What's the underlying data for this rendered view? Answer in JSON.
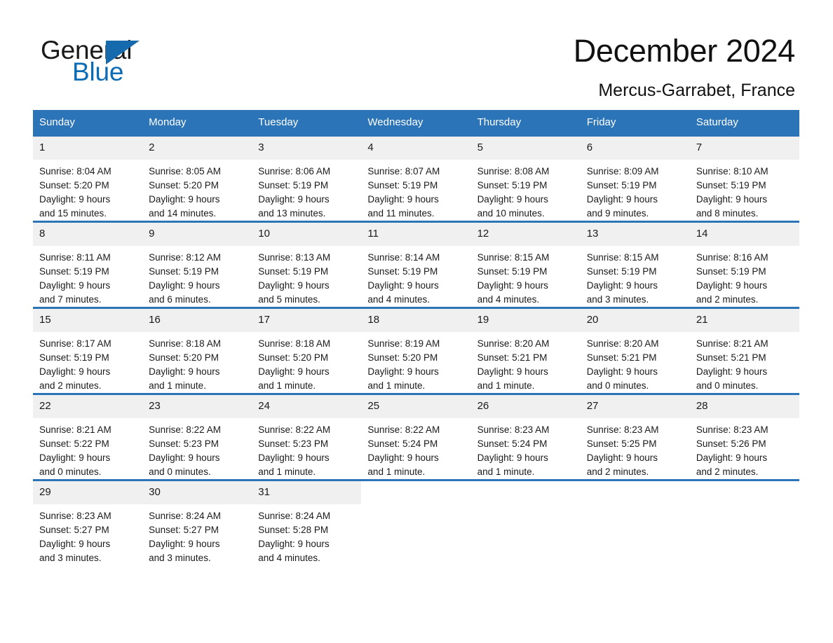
{
  "brand": {
    "name_part1": "General",
    "name_part2": "Blue",
    "triangle_color": "#1569ad",
    "blue_color": "#0b6cb5"
  },
  "header": {
    "title": "December 2024",
    "subtitle": "Mercus-Garrabet, France"
  },
  "theme": {
    "header_blue": "#2b74b8",
    "day_band_gray": "#f0f0f0",
    "text_color": "#1a1a1a"
  },
  "weekdays": [
    "Sunday",
    "Monday",
    "Tuesday",
    "Wednesday",
    "Thursday",
    "Friday",
    "Saturday"
  ],
  "weeks": [
    {
      "days": [
        {
          "day": "1",
          "sunrise": "Sunrise: 8:04 AM",
          "sunset": "Sunset: 5:20 PM",
          "daylight1": "Daylight: 9 hours",
          "daylight2": "and 15 minutes."
        },
        {
          "day": "2",
          "sunrise": "Sunrise: 8:05 AM",
          "sunset": "Sunset: 5:20 PM",
          "daylight1": "Daylight: 9 hours",
          "daylight2": "and 14 minutes."
        },
        {
          "day": "3",
          "sunrise": "Sunrise: 8:06 AM",
          "sunset": "Sunset: 5:19 PM",
          "daylight1": "Daylight: 9 hours",
          "daylight2": "and 13 minutes."
        },
        {
          "day": "4",
          "sunrise": "Sunrise: 8:07 AM",
          "sunset": "Sunset: 5:19 PM",
          "daylight1": "Daylight: 9 hours",
          "daylight2": "and 11 minutes."
        },
        {
          "day": "5",
          "sunrise": "Sunrise: 8:08 AM",
          "sunset": "Sunset: 5:19 PM",
          "daylight1": "Daylight: 9 hours",
          "daylight2": "and 10 minutes."
        },
        {
          "day": "6",
          "sunrise": "Sunrise: 8:09 AM",
          "sunset": "Sunset: 5:19 PM",
          "daylight1": "Daylight: 9 hours",
          "daylight2": "and 9 minutes."
        },
        {
          "day": "7",
          "sunrise": "Sunrise: 8:10 AM",
          "sunset": "Sunset: 5:19 PM",
          "daylight1": "Daylight: 9 hours",
          "daylight2": "and 8 minutes."
        }
      ]
    },
    {
      "days": [
        {
          "day": "8",
          "sunrise": "Sunrise: 8:11 AM",
          "sunset": "Sunset: 5:19 PM",
          "daylight1": "Daylight: 9 hours",
          "daylight2": "and 7 minutes."
        },
        {
          "day": "9",
          "sunrise": "Sunrise: 8:12 AM",
          "sunset": "Sunset: 5:19 PM",
          "daylight1": "Daylight: 9 hours",
          "daylight2": "and 6 minutes."
        },
        {
          "day": "10",
          "sunrise": "Sunrise: 8:13 AM",
          "sunset": "Sunset: 5:19 PM",
          "daylight1": "Daylight: 9 hours",
          "daylight2": "and 5 minutes."
        },
        {
          "day": "11",
          "sunrise": "Sunrise: 8:14 AM",
          "sunset": "Sunset: 5:19 PM",
          "daylight1": "Daylight: 9 hours",
          "daylight2": "and 4 minutes."
        },
        {
          "day": "12",
          "sunrise": "Sunrise: 8:15 AM",
          "sunset": "Sunset: 5:19 PM",
          "daylight1": "Daylight: 9 hours",
          "daylight2": "and 4 minutes."
        },
        {
          "day": "13",
          "sunrise": "Sunrise: 8:15 AM",
          "sunset": "Sunset: 5:19 PM",
          "daylight1": "Daylight: 9 hours",
          "daylight2": "and 3 minutes."
        },
        {
          "day": "14",
          "sunrise": "Sunrise: 8:16 AM",
          "sunset": "Sunset: 5:19 PM",
          "daylight1": "Daylight: 9 hours",
          "daylight2": "and 2 minutes."
        }
      ]
    },
    {
      "days": [
        {
          "day": "15",
          "sunrise": "Sunrise: 8:17 AM",
          "sunset": "Sunset: 5:19 PM",
          "daylight1": "Daylight: 9 hours",
          "daylight2": "and 2 minutes."
        },
        {
          "day": "16",
          "sunrise": "Sunrise: 8:18 AM",
          "sunset": "Sunset: 5:20 PM",
          "daylight1": "Daylight: 9 hours",
          "daylight2": "and 1 minute."
        },
        {
          "day": "17",
          "sunrise": "Sunrise: 8:18 AM",
          "sunset": "Sunset: 5:20 PM",
          "daylight1": "Daylight: 9 hours",
          "daylight2": "and 1 minute."
        },
        {
          "day": "18",
          "sunrise": "Sunrise: 8:19 AM",
          "sunset": "Sunset: 5:20 PM",
          "daylight1": "Daylight: 9 hours",
          "daylight2": "and 1 minute."
        },
        {
          "day": "19",
          "sunrise": "Sunrise: 8:20 AM",
          "sunset": "Sunset: 5:21 PM",
          "daylight1": "Daylight: 9 hours",
          "daylight2": "and 1 minute."
        },
        {
          "day": "20",
          "sunrise": "Sunrise: 8:20 AM",
          "sunset": "Sunset: 5:21 PM",
          "daylight1": "Daylight: 9 hours",
          "daylight2": "and 0 minutes."
        },
        {
          "day": "21",
          "sunrise": "Sunrise: 8:21 AM",
          "sunset": "Sunset: 5:21 PM",
          "daylight1": "Daylight: 9 hours",
          "daylight2": "and 0 minutes."
        }
      ]
    },
    {
      "days": [
        {
          "day": "22",
          "sunrise": "Sunrise: 8:21 AM",
          "sunset": "Sunset: 5:22 PM",
          "daylight1": "Daylight: 9 hours",
          "daylight2": "and 0 minutes."
        },
        {
          "day": "23",
          "sunrise": "Sunrise: 8:22 AM",
          "sunset": "Sunset: 5:23 PM",
          "daylight1": "Daylight: 9 hours",
          "daylight2": "and 0 minutes."
        },
        {
          "day": "24",
          "sunrise": "Sunrise: 8:22 AM",
          "sunset": "Sunset: 5:23 PM",
          "daylight1": "Daylight: 9 hours",
          "daylight2": "and 1 minute."
        },
        {
          "day": "25",
          "sunrise": "Sunrise: 8:22 AM",
          "sunset": "Sunset: 5:24 PM",
          "daylight1": "Daylight: 9 hours",
          "daylight2": "and 1 minute."
        },
        {
          "day": "26",
          "sunrise": "Sunrise: 8:23 AM",
          "sunset": "Sunset: 5:24 PM",
          "daylight1": "Daylight: 9 hours",
          "daylight2": "and 1 minute."
        },
        {
          "day": "27",
          "sunrise": "Sunrise: 8:23 AM",
          "sunset": "Sunset: 5:25 PM",
          "daylight1": "Daylight: 9 hours",
          "daylight2": "and 2 minutes."
        },
        {
          "day": "28",
          "sunrise": "Sunrise: 8:23 AM",
          "sunset": "Sunset: 5:26 PM",
          "daylight1": "Daylight: 9 hours",
          "daylight2": "and 2 minutes."
        }
      ]
    },
    {
      "days": [
        {
          "day": "29",
          "sunrise": "Sunrise: 8:23 AM",
          "sunset": "Sunset: 5:27 PM",
          "daylight1": "Daylight: 9 hours",
          "daylight2": "and 3 minutes."
        },
        {
          "day": "30",
          "sunrise": "Sunrise: 8:24 AM",
          "sunset": "Sunset: 5:27 PM",
          "daylight1": "Daylight: 9 hours",
          "daylight2": "and 3 minutes."
        },
        {
          "day": "31",
          "sunrise": "Sunrise: 8:24 AM",
          "sunset": "Sunset: 5:28 PM",
          "daylight1": "Daylight: 9 hours",
          "daylight2": "and 4 minutes."
        },
        {
          "day": "",
          "sunrise": "",
          "sunset": "",
          "daylight1": "",
          "daylight2": ""
        },
        {
          "day": "",
          "sunrise": "",
          "sunset": "",
          "daylight1": "",
          "daylight2": ""
        },
        {
          "day": "",
          "sunrise": "",
          "sunset": "",
          "daylight1": "",
          "daylight2": ""
        },
        {
          "day": "",
          "sunrise": "",
          "sunset": "",
          "daylight1": "",
          "daylight2": ""
        }
      ]
    }
  ]
}
